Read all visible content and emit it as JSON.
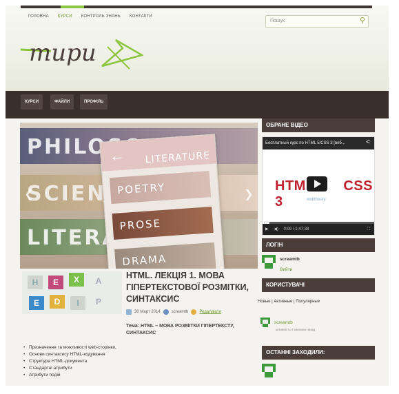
{
  "header": {
    "nav": [
      "ГОЛОВНА",
      "КУРСИ",
      "КОНТРОЛЬ ЗНАНЬ",
      "КОНТАКТИ"
    ],
    "active_nav": "КУРСИ",
    "search_placeholder": "Пошук",
    "logo_text": "тири"
  },
  "navbar": {
    "items": [
      "КУРСИ",
      "ФАЙЛИ",
      "ПРОФІЛЬ"
    ]
  },
  "slider": {
    "strips": [
      "PHILOSO",
      "SCIENCE",
      "LITERA"
    ],
    "card_title": "LITERATURE",
    "tiles": [
      "POETRY",
      "PROSE",
      "DRAMA"
    ]
  },
  "post": {
    "title": "HTML. ЛЕКЦІЯ 1. МОВА ГІПЕРТЕКСТОВОЇ РОЗМІТКИ, СИНТАКСИС",
    "date": "30 Март 2014",
    "author": "screamtb",
    "edit": "Редагувати",
    "subtitle": "Тема: HTML – МОВА РОЗМІТКИ ГІПЕРТЕКСТУ, СИНТАКСИС",
    "list": [
      "Призначення та можливості web-сторінки,",
      "Основи синтаксису HTML-кодування",
      "Структура HTML-документа",
      "Стандартні атрибути",
      "Атрибути подій"
    ],
    "thumb_letters": [
      "H",
      "E",
      "X",
      "A",
      "E",
      "D",
      "I",
      "P"
    ]
  },
  "sidebar": {
    "video_title": "ОБРАНЕ ВІДЕО",
    "video_caption": "Бесплатный курс по HTML 5/CSS 3 [веб...",
    "video_brand_left": "HTML",
    "video_brand_right": "CSS 3",
    "video_sub": "webtheory",
    "video_time": "0:00 / 1:47:38",
    "video_progress": 0.0,
    "login_title": "ЛОГІН",
    "login_user": "screamtb",
    "login_logout": "Вийти",
    "users_title": "КОРИСТУВАЧІ",
    "users_tabs": "Новые | Активные | Популярные",
    "users_user": "screamtb",
    "users_ago": "активність 4 хвилини назад",
    "last_title": "ОСТАННІ ЗАХОДИЛИ:"
  },
  "colors": {
    "accent_green": "#8cc63f",
    "dark_brown": "#3b2f2c",
    "sidebar_head": "#4a3d3a",
    "link_green": "#6a9a2a",
    "video_red": "#c0212f"
  }
}
